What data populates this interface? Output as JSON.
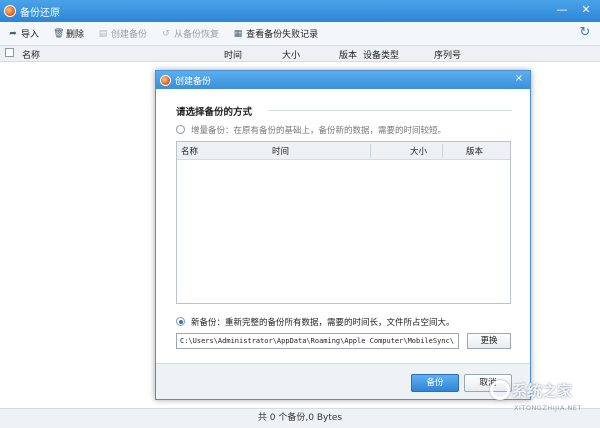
{
  "window": {
    "title": "备份还原",
    "controls": {
      "minimize": "—",
      "close": "✕"
    }
  },
  "toolbar": {
    "buttons": [
      {
        "label": "导入",
        "icon": "import-icon",
        "enabled": true
      },
      {
        "label": "删除",
        "icon": "trash-icon",
        "enabled": true
      },
      {
        "label": "创建备份",
        "icon": "create-backup-icon",
        "enabled": false
      },
      {
        "label": "从备份恢复",
        "icon": "restore-icon",
        "enabled": false
      },
      {
        "label": "查看备份失败记录",
        "icon": "log-icon",
        "enabled": true
      }
    ],
    "refresh_icon": "refresh-icon"
  },
  "main_table": {
    "columns": [
      "名称",
      "时间",
      "大小",
      "版本",
      "设备类型",
      "序列号"
    ]
  },
  "status": {
    "text": "共 0 个备份,0 Bytes"
  },
  "dialog": {
    "title": "创建备份",
    "close": "×",
    "section_title": "请选择备份的方式",
    "option_incremental": "增量备份：在原有备份的基础上，备份新的数据，需要的时间较短。",
    "option_incremental_selected": false,
    "list_columns": [
      "名称",
      "时间",
      "大小",
      "版本"
    ],
    "option_new": "新备份：重新完整的备份所有数据，需要的时间长，文件所占空间大。",
    "option_new_selected": true,
    "path_value": "C:\\Users\\Administrator\\AppData\\Roaming\\Apple Computer\\MobileSync\\",
    "change_label": "更换",
    "ok_label": "备份",
    "cancel_label": "取消"
  },
  "watermark": {
    "text": "系统之家",
    "sub": "XITONGZHIJIA.NET"
  },
  "colors": {
    "title_bar": "#2d86d6",
    "primary_button": "#2f84d4",
    "toolbar_bg": "#f3f6fa"
  }
}
